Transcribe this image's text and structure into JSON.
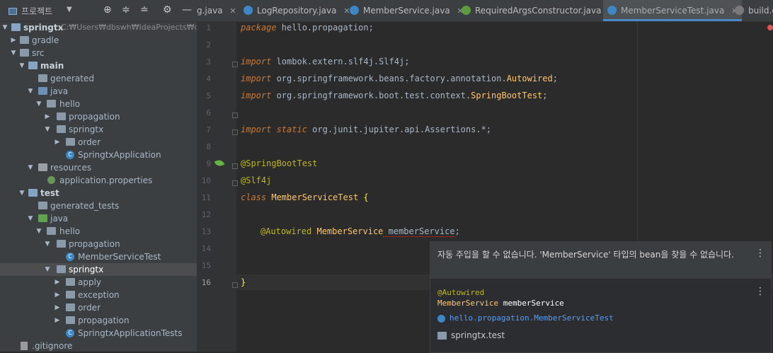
{
  "project_panel": {
    "title": "프로젝트",
    "tree": [
      {
        "label": "springtx",
        "suffix": "C:₩Users₩dbswh₩IdeaProjects₩db₩"
      },
      {
        "label": "gradle"
      },
      {
        "label": "src"
      },
      {
        "label": "main"
      },
      {
        "label": "generated"
      },
      {
        "label": "java"
      },
      {
        "label": "hello"
      },
      {
        "label": "propagation"
      },
      {
        "label": "springtx"
      },
      {
        "label": "order"
      },
      {
        "label": "SpringtxApplication"
      },
      {
        "label": "resources"
      },
      {
        "label": "application.properties"
      },
      {
        "label": "test"
      },
      {
        "label": "generated_tests"
      },
      {
        "label": "java"
      },
      {
        "label": "hello"
      },
      {
        "label": "propagation"
      },
      {
        "label": "MemberServiceTest"
      },
      {
        "label": "springtx"
      },
      {
        "label": "apply"
      },
      {
        "label": "exception"
      },
      {
        "label": "order"
      },
      {
        "label": "propagation"
      },
      {
        "label": "SpringtxApplicationTests"
      },
      {
        "label": ".gitignore"
      }
    ]
  },
  "tabs": [
    {
      "label": "g.java"
    },
    {
      "label": "LogRepository.java"
    },
    {
      "label": "MemberService.java"
    },
    {
      "label": "RequiredArgsConstructor.java"
    },
    {
      "label": "MemberServiceTest.java"
    },
    {
      "label": "build.gi"
    }
  ],
  "editor": {
    "line_numbers": [
      "1",
      "2",
      "3",
      "4",
      "5",
      "6",
      "7",
      "8",
      "9",
      "10",
      "11",
      "12",
      "13",
      "14",
      "15",
      "16"
    ],
    "code": {
      "l1_kw": "package",
      "l1_rest": " hello.propagation;",
      "l3_kw": "import",
      "l3_rest": " lombok.extern.slf4j.Slf4j;",
      "l4_kw": "import",
      "l4_pkg": " org.springframework.beans.factory.annotation.",
      "l4_cls": "Autowired",
      "l4_end": ";",
      "l5_kw": "import",
      "l5_pkg": " org.springframework.boot.test.context.",
      "l5_cls": "SpringBootTest",
      "l5_end": ";",
      "l7_kw": "import static",
      "l7_rest": " org.junit.jupiter.api.Assertions.*;",
      "l9": "@SpringBootTest",
      "l10": "@Slf4j",
      "l11_kw": "class",
      "l11_cls": " MemberServiceTest",
      "l11_brace": " {",
      "l13_ann": "@Autowired",
      "l13_type": " MemberService",
      "l13_field": " memberService",
      "l13_end": ";",
      "l16": "}"
    }
  },
  "popup": {
    "message": "자동 주입을 할 수 없습니다. 'MemberService' 타입의 bean을 찾을 수 없습니다.",
    "code_annotation": "@Autowired",
    "code_type": "MemberService",
    "code_field": " memberService",
    "reference": "hello.propagation.MemberServiceTest",
    "module": "springtx.test"
  },
  "colors": {
    "keyword": "#cc7832",
    "annotation": "#bbb529",
    "class": "#ffc66d",
    "selection": "#4b4d4f",
    "active_tab_border": "#4a88c7"
  }
}
